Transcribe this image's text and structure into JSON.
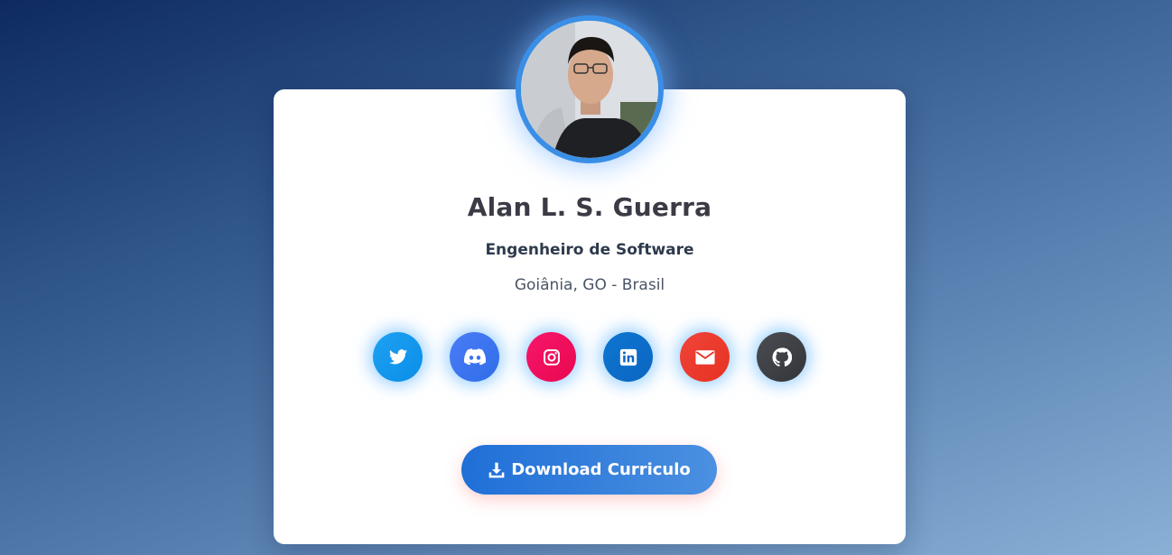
{
  "profile": {
    "name": "Alan L. S. Guerra",
    "role": "Engenheiro de Software",
    "location": "Goiânia, GO - Brasil"
  },
  "social_links": [
    {
      "name": "twitter",
      "icon": "twitter-icon",
      "color": "#1da1f2"
    },
    {
      "name": "discord",
      "icon": "discord-icon",
      "color": "#3b74f0"
    },
    {
      "name": "instagram",
      "icon": "instagram-icon",
      "color": "#f0105d"
    },
    {
      "name": "linkedin",
      "icon": "linkedin-icon",
      "color": "#0a66c2"
    },
    {
      "name": "email",
      "icon": "envelope-icon",
      "color": "#ea3a2c"
    },
    {
      "name": "github",
      "icon": "github-icon",
      "color": "#3d4044"
    }
  ],
  "download": {
    "label": "Download Curriculo",
    "icon": "download-icon"
  },
  "colors": {
    "accent": "#1f6fd8",
    "avatar_ring": "#3a8ee6",
    "name_text": "#3b3b45"
  }
}
